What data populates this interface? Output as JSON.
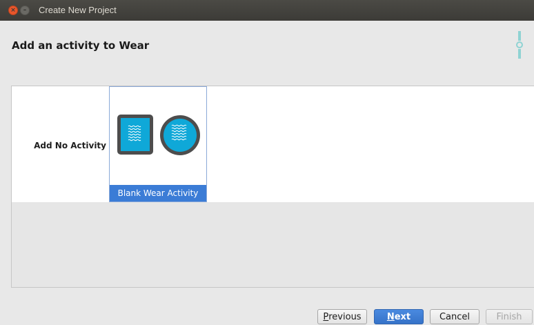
{
  "window": {
    "title": "Create New Project"
  },
  "page": {
    "title": "Add an activity to Wear"
  },
  "gallery": {
    "options": [
      {
        "label": "Add No Activity",
        "selected": false
      },
      {
        "label": "Blank Wear Activity",
        "selected": true,
        "icon": "wear-square-and-round-watch-icon"
      }
    ]
  },
  "buttons": {
    "previous": {
      "mnemonic": "P",
      "rest": "revious",
      "enabled": true
    },
    "next": {
      "mnemonic": "N",
      "rest": "ext",
      "enabled": true,
      "default": true
    },
    "cancel": {
      "label": "Cancel",
      "enabled": true
    },
    "finish": {
      "label": "Finish",
      "enabled": false
    }
  },
  "colors": {
    "selection": "#3b7cd6",
    "wear_blue": "#0fa8d8",
    "logo_teal": "#8fd3d3"
  }
}
